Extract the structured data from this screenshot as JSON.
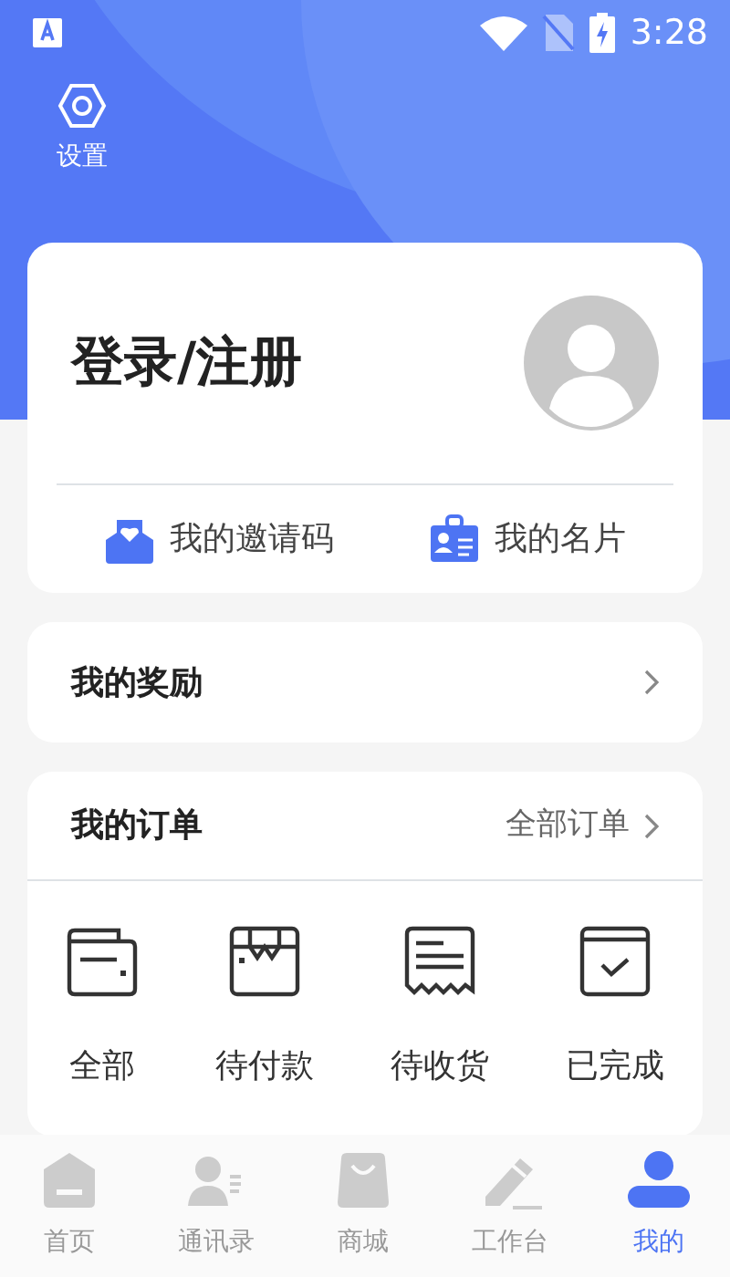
{
  "status_bar": {
    "time": "3:28"
  },
  "settings": {
    "label": "设置"
  },
  "profile": {
    "title": "登录/注册"
  },
  "quick_links": [
    {
      "label": "我的邀请码",
      "kind": "invite"
    },
    {
      "label": "我的名片",
      "kind": "card"
    }
  ],
  "rewards": {
    "title": "我的奖励"
  },
  "orders": {
    "title": "我的订单",
    "all_label": "全部订单",
    "items": [
      {
        "label": "全部",
        "kind": "all"
      },
      {
        "label": "待付款",
        "kind": "pay"
      },
      {
        "label": "待收货",
        "kind": "receive"
      },
      {
        "label": "已完成",
        "kind": "done"
      }
    ]
  },
  "tab_bar": [
    {
      "label": "首页",
      "kind": "home",
      "selected": false
    },
    {
      "label": "通讯录",
      "kind": "contacts",
      "selected": false
    },
    {
      "label": "商城",
      "kind": "shop",
      "selected": false
    },
    {
      "label": "工作台",
      "kind": "work",
      "selected": false
    },
    {
      "label": "我的",
      "kind": "me",
      "selected": true
    }
  ]
}
